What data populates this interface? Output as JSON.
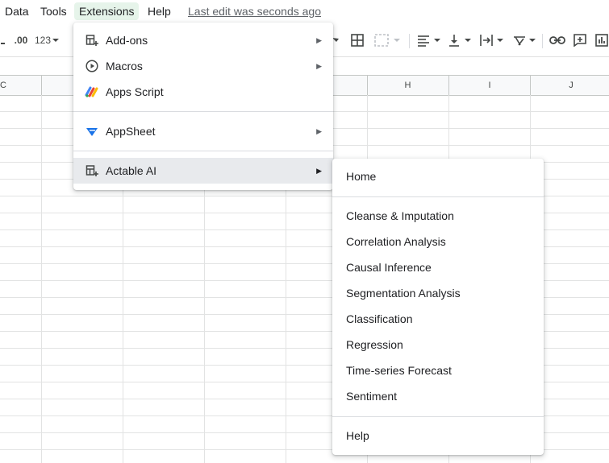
{
  "menubar": {
    "items": [
      "Data",
      "Tools",
      "Extensions",
      "Help"
    ],
    "last_edit": "Last edit was seconds ago"
  },
  "toolbar": {
    "decimal_label": ".00",
    "format_label": "123"
  },
  "columns": [
    "C",
    "H",
    "I",
    "J"
  ],
  "extensions_menu": {
    "items": [
      {
        "label": "Add-ons",
        "icon": "addons-icon",
        "submenu": true
      },
      {
        "label": "Macros",
        "icon": "play-circle-icon",
        "submenu": true
      },
      {
        "label": "Apps Script",
        "icon": "apps-script-icon",
        "submenu": false
      },
      {
        "label": "AppSheet",
        "icon": "appsheet-icon",
        "submenu": true
      },
      {
        "label": "Actable AI",
        "icon": "addon-app-icon",
        "submenu": true,
        "highlighted": true
      }
    ]
  },
  "actable_submenu": {
    "items": [
      "Home",
      "Cleanse & Imputation",
      "Correlation Analysis",
      "Causal Inference",
      "Segmentation Analysis",
      "Classification",
      "Regression",
      "Time-series Forecast",
      "Sentiment",
      "Help"
    ]
  },
  "colors": {
    "active_menu_bg": "#e6f4ea",
    "highlight_bg": "#e8eaed",
    "appsheet_blue": "#1a73e8"
  }
}
